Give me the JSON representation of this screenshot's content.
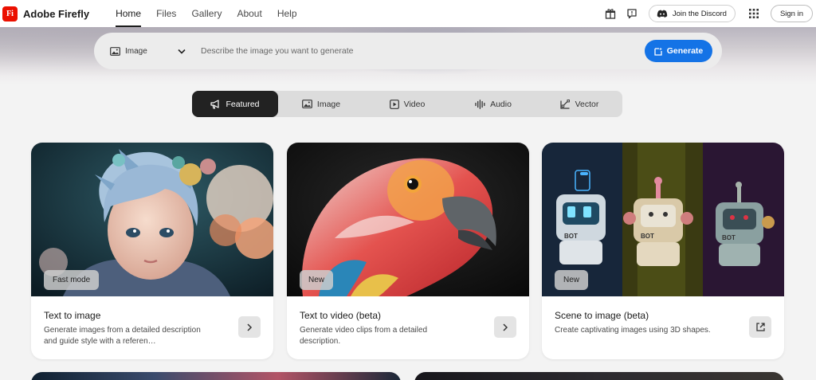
{
  "brand": {
    "logo_text": "Fi",
    "name": "Adobe Firefly",
    "logo_color": "#eb1000"
  },
  "nav": {
    "items": [
      {
        "label": "Home",
        "active": true
      },
      {
        "label": "Files",
        "active": false
      },
      {
        "label": "Gallery",
        "active": false
      },
      {
        "label": "About",
        "active": false
      },
      {
        "label": "Help",
        "active": false
      }
    ]
  },
  "header_right": {
    "icons": [
      "gift-icon",
      "feedback-icon"
    ],
    "discord_label": "Join the Discord",
    "apps_icon": "apps-grid-icon",
    "signin_label": "Sign in"
  },
  "prompt": {
    "type_selected": "Image",
    "placeholder": "Describe the image you want to generate",
    "value": "",
    "generate_label": "Generate",
    "accent_color": "#1473e6"
  },
  "tabs": [
    {
      "label": "Featured",
      "icon": "megaphone-icon",
      "active": true
    },
    {
      "label": "Image",
      "icon": "image-icon",
      "active": false
    },
    {
      "label": "Video",
      "icon": "video-icon",
      "active": false
    },
    {
      "label": "Audio",
      "icon": "audio-wave-icon",
      "active": false
    },
    {
      "label": "Vector",
      "icon": "vector-icon",
      "active": false
    }
  ],
  "cards": [
    {
      "badge": "Fast mode",
      "title": "Text to image",
      "description": "Generate images from a detailed description and guide style with a referen…",
      "action_icon": "chevron-right-icon"
    },
    {
      "badge": "New",
      "title": "Text to video (beta)",
      "description": "Generate video clips from a detailed description.",
      "action_icon": "chevron-right-icon"
    },
    {
      "badge": "New",
      "title": "Scene to image (beta)",
      "description": "Create captivating images using 3D shapes.",
      "action_icon": "open-external-icon"
    }
  ]
}
